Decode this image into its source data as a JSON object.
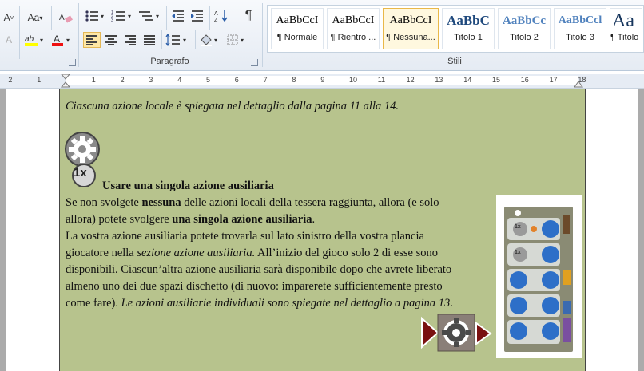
{
  "ribbon": {
    "font_buttons": [
      "A",
      "Aa",
      "ab",
      "A"
    ],
    "paragraph_label": "Paragrafo",
    "styles_label": "Stili",
    "pilcrow": "¶",
    "styles": [
      {
        "preview": "AaBbCcI",
        "name": "¶ Normale"
      },
      {
        "preview": "AaBbCcI",
        "name": "¶ Rientro ..."
      },
      {
        "preview": "AaBbCcI",
        "name": "¶ Nessuna..."
      },
      {
        "preview": "AaBbC",
        "name": "Titolo 1"
      },
      {
        "preview": "AaBbCc",
        "name": "Titolo 2"
      },
      {
        "preview": "AaBbCcl",
        "name": "Titolo 3"
      },
      {
        "preview": "Aa",
        "name": "¶ Titolo"
      }
    ],
    "colors": {
      "accent": "#fde7a6",
      "heading": "#1f497d",
      "heading2": "#4f81bd"
    }
  },
  "ruler": {
    "left_numbers": [
      "2",
      "1"
    ],
    "numbers": [
      "1",
      "2",
      "3",
      "4",
      "5",
      "6",
      "7",
      "8",
      "9",
      "10",
      "11",
      "12",
      "13",
      "14",
      "15",
      "16",
      "17",
      "18"
    ]
  },
  "document": {
    "line1": "Ciascuna azione locale è spiegata nel dettaglio dalla pagina 11 alla 14.",
    "badge": "1x",
    "heading": "Usare una singola azione ausiliaria",
    "p1_a": "Se non svolgete ",
    "p1_b": "nessuna",
    "p1_c": " delle azioni locali della tessera raggiunta, allora (e solo",
    "p2_a": "allora) potete svolgere ",
    "p2_b": "una singola azione ausiliaria",
    "p2_c": ".",
    "p3": "La vostra azione ausiliaria potete trovarla sul lato sinistro della vostra plancia",
    "p4_a": "giocatore nella ",
    "p4_b": "sezione azione ausiliaria.",
    "p4_c": " All’inizio del gioco solo 2 di esse sono",
    "p5": "disponibili. Ciascun’altra azione ausiliaria sarà disponibile dopo che avrete liberato",
    "p6": "almeno uno dei due spazi dischetto (di nuovo: imparerete sufficientemente presto",
    "p7_a": "come fare). ",
    "p7_b": "Le azioni ausiliarie individuali sono spiegate nel dettaglio a pagina 13",
    "p7_c": ".",
    "board_tokens": [
      "1x",
      "1x"
    ]
  }
}
